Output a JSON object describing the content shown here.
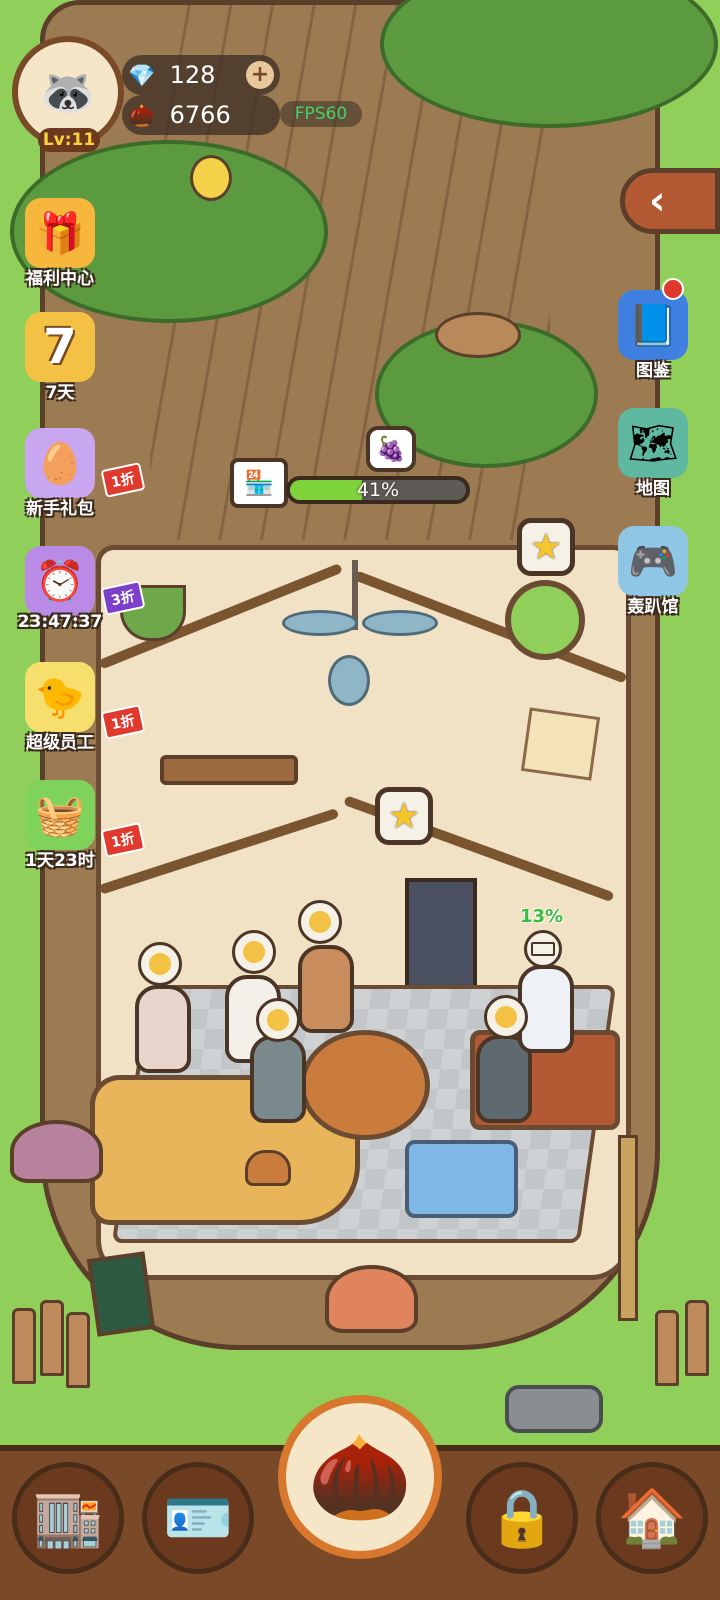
{
  "player": {
    "avatar_icon": "🦝",
    "level_label": "Lv:11"
  },
  "resources": {
    "gems": "128",
    "seeds": "6766",
    "fps_label": "FPS60",
    "gem_icon": "💎",
    "seed_icon": "🌰",
    "plus_label": "+"
  },
  "side_left": [
    {
      "id": "welfare",
      "label": "福利中心",
      "icon": "🎁",
      "icon_color": "#f6b73c"
    },
    {
      "id": "sevenday",
      "label": "7天",
      "icon": "7",
      "icon_color": "#f3c244"
    },
    {
      "id": "starter",
      "label": "新手礼包",
      "icon": "🥚",
      "icon_color": "#c9a6f0",
      "badge": "1折"
    },
    {
      "id": "timer",
      "label": "23:47:37",
      "icon": "⏰",
      "icon_color": "#b98ae6",
      "badge": "3折"
    },
    {
      "id": "super_staff",
      "label": "超级员工",
      "icon": "🐤",
      "icon_color": "#f7df6e",
      "badge": "1折"
    },
    {
      "id": "box",
      "label": "1天23时",
      "icon": "🧺",
      "icon_color": "#7fd35a",
      "badge": "1折"
    }
  ],
  "side_right": [
    {
      "id": "codex",
      "label": "图鉴",
      "icon": "📘",
      "icon_color": "#3f7fe0"
    },
    {
      "id": "map",
      "label": "地图",
      "icon": "🗺",
      "icon_color": "#5fb8a0"
    },
    {
      "id": "arcade",
      "label": "轰趴馆",
      "icon": "🎮",
      "icon_color": "#8fc6e6"
    }
  ],
  "collapse_icon": "‹",
  "shop_progress": {
    "percent_label": "41%",
    "fraction": 0.41,
    "shop_icon": "🏪",
    "reward_icon": "🍇"
  },
  "stars": {
    "icon": "★"
  },
  "task": {
    "percent_label": "13%"
  },
  "bottom_nav": [
    {
      "id": "shop",
      "icon": "🏬"
    },
    {
      "id": "staff",
      "icon": "🪪"
    },
    {
      "id": "acorn",
      "icon": "🌰"
    },
    {
      "id": "locked",
      "icon": "🔒"
    },
    {
      "id": "home",
      "icon": "🏠"
    }
  ],
  "colors": {
    "grass": "#8fcf5a",
    "trunk": "#9c7a52",
    "progress_fill": "#7ed33a",
    "discount_red": "#e03a2f",
    "discount_purple": "#7b3fc9",
    "fps_green": "#3fd26b"
  }
}
